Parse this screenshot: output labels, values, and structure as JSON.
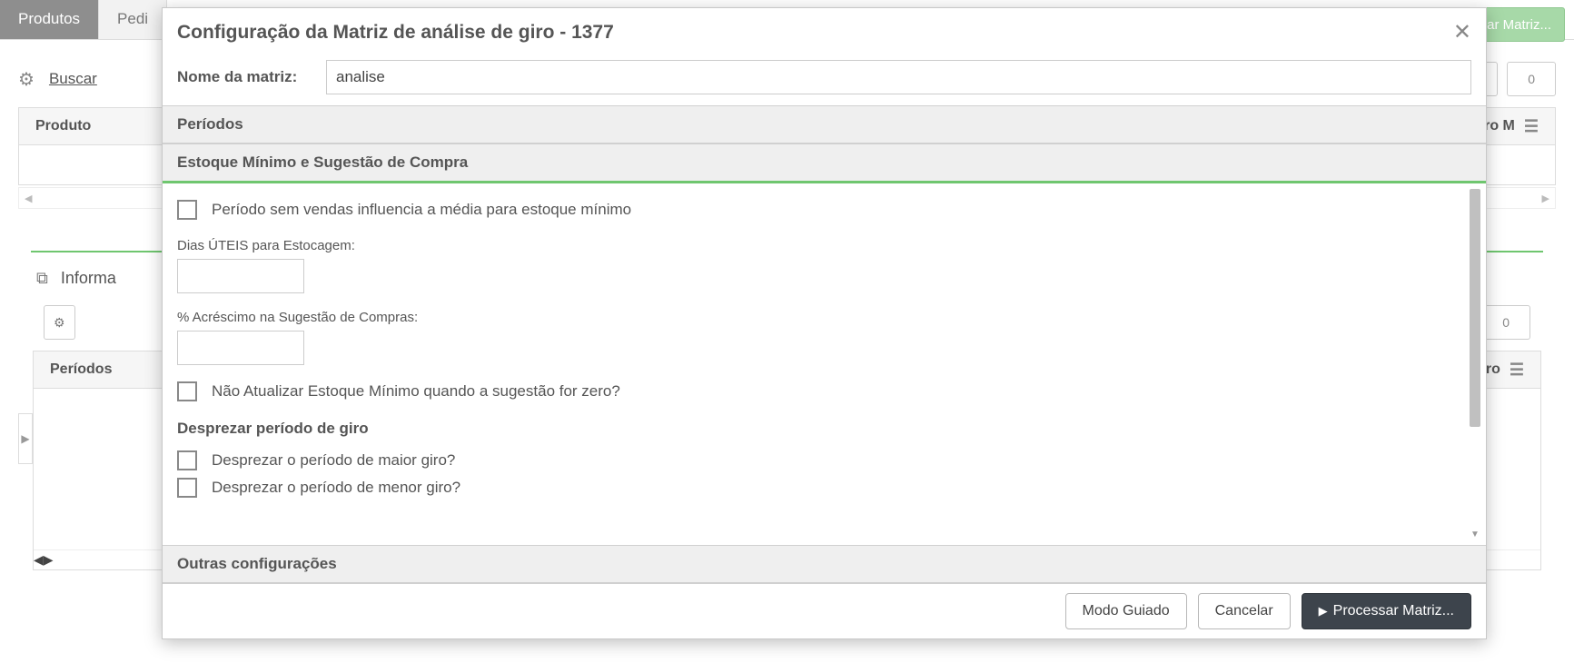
{
  "tabs": {
    "produtos": "Produtos",
    "pedidos_partial": "Pedi"
  },
  "top_button": "rocessar Matriz...",
  "toolbar": {
    "buscar": "Buscar",
    "count": "0"
  },
  "grid1": {
    "col_left": "Produto",
    "col_right": "g.Compra Giro M"
  },
  "subtab": {
    "informa": "Informa"
  },
  "toolbar2": {
    "count": "0"
  },
  "grid2": {
    "col_left": "Períodos",
    "col_right": "Vlr Lucro"
  },
  "modal": {
    "title": "Configuração da Matriz de análise de giro - 1377",
    "name_label": "Nome da matriz:",
    "name_value": "analise",
    "section_periodos": "Períodos",
    "section_estoque": "Estoque Mínimo e Sugestão de Compra",
    "chk_periodo_sem_vendas": "Período sem vendas influencia a média para estoque mínimo",
    "label_dias_uteis": "Dias ÚTEIS para Estocagem:",
    "label_acrescimo": "% Acréscimo na Sugestão de Compras:",
    "chk_nao_atualizar": "Não Atualizar Estoque Mínimo quando a sugestão for zero?",
    "sub_desprezar": "Desprezar período de giro",
    "chk_maior_giro": "Desprezar o período de maior giro?",
    "chk_menor_giro": "Desprezar o período de menor giro?",
    "section_outras": "Outras configurações",
    "btn_modo": "Modo Guiado",
    "btn_cancelar": "Cancelar",
    "btn_processar": "Processar Matriz..."
  }
}
